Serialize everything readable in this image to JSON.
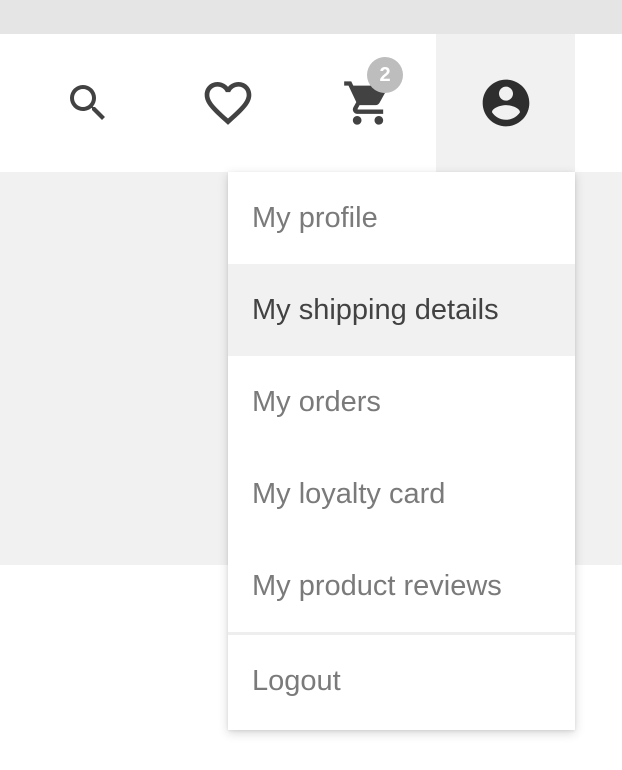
{
  "header": {
    "icons": {
      "search": "search-icon",
      "wishlist": "heart-outline-icon",
      "cart": "shopping-cart-icon",
      "account": "account-circle-icon"
    },
    "cart_count": "2"
  },
  "account_menu": {
    "items": [
      {
        "label": "My profile"
      },
      {
        "label": "My shipping details",
        "highlighted": true
      },
      {
        "label": "My orders"
      },
      {
        "label": "My loyalty card"
      },
      {
        "label": "My product reviews"
      }
    ],
    "logout_label": "Logout"
  },
  "colors": {
    "icon": "#424242",
    "badge": "#bdbdbd",
    "menu_text": "#7a7a7a",
    "menu_text_active": "#424242",
    "highlight_bg": "#f1f1f1"
  }
}
